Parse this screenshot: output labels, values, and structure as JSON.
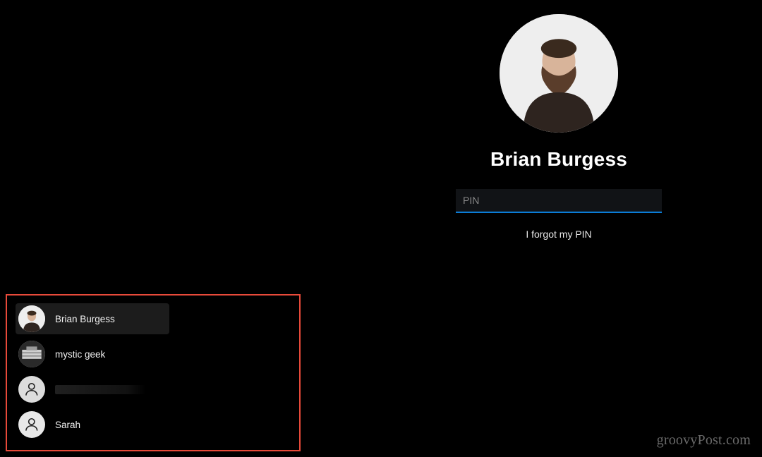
{
  "login": {
    "display_name": "Brian Burgess",
    "pin_placeholder": "PIN",
    "pin_value": "",
    "forgot_label": "I forgot my PIN"
  },
  "accounts": [
    {
      "name": "Brian Burgess",
      "avatar": "photo-brian",
      "selected": true
    },
    {
      "name": "mystic geek",
      "avatar": "photo-misc",
      "selected": false
    },
    {
      "name": "",
      "avatar": "generic",
      "selected": false,
      "redacted": true
    },
    {
      "name": "Sarah",
      "avatar": "generic",
      "selected": false
    }
  ],
  "watermark": "groovyPost.com",
  "colors": {
    "accent": "#0a7cd6",
    "highlight_box": "#e84a3a"
  }
}
